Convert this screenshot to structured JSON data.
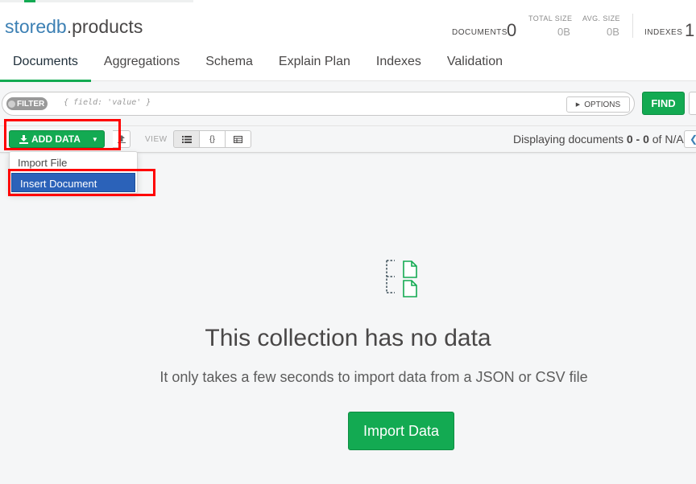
{
  "collection": {
    "db": "storedb",
    "name": ".products"
  },
  "stats": {
    "documents_label": "DOCUMENTS",
    "documents_value": "0",
    "total_size_label": "TOTAL SIZE",
    "total_size_value": "0B",
    "avg_size_label": "AVG. SIZE",
    "avg_size_value": "0B",
    "indexes_label": "INDEXES",
    "indexes_value": "1"
  },
  "tabs": [
    {
      "label": "Documents"
    },
    {
      "label": "Aggregations"
    },
    {
      "label": "Schema"
    },
    {
      "label": "Explain Plan"
    },
    {
      "label": "Indexes"
    },
    {
      "label": "Validation"
    }
  ],
  "filter": {
    "pill": "FILTER",
    "placeholder": "{ field: 'value' }",
    "options_label": "OPTIONS",
    "find_label": "FIND"
  },
  "toolbar": {
    "add_data_label": "ADD DATA",
    "view_label": "VIEW",
    "paging_prefix": "Displaying documents ",
    "paging_range": "0 - 0",
    "paging_suffix": " of N/A"
  },
  "add_data_menu": [
    {
      "label": "Import File"
    },
    {
      "label": "Insert Document"
    }
  ],
  "empty_state": {
    "title": "This collection has no data",
    "subtitle": "It only takes a few seconds to import data from a JSON or CSV file",
    "button_label": "Import Data"
  },
  "colors": {
    "accent": "#13aa52",
    "highlight": "#ff0000",
    "selected_menu": "#2b62b9",
    "db_name": "#3c80b4"
  }
}
